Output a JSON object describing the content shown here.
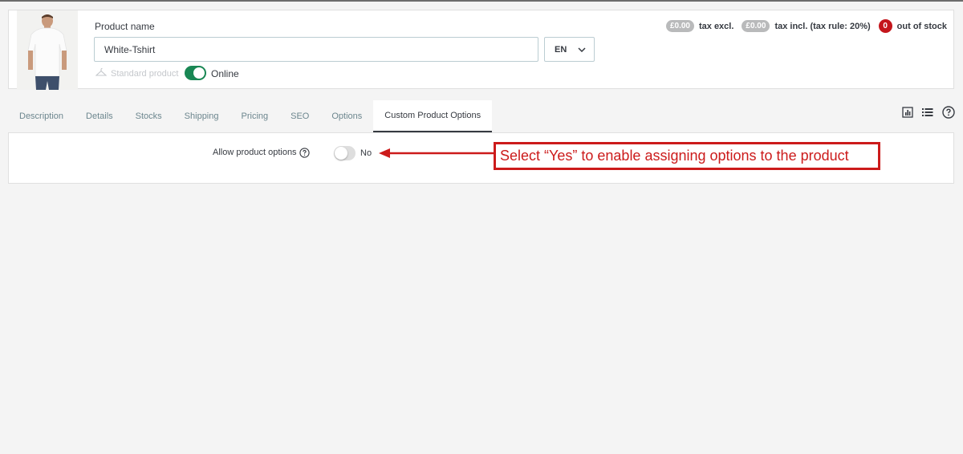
{
  "header": {
    "product_image_alt": "White T-shirt product photo",
    "product_name_label": "Product name",
    "product_name_value": "White-Tshirt",
    "language": "EN",
    "product_type": "Standard product",
    "status_label": "Online",
    "status_online": true
  },
  "price_bar": {
    "price_tax_excl": "£0.00",
    "tax_excl_label": "tax excl.",
    "price_tax_incl": "£0.00",
    "tax_incl_label": "tax incl. (tax rule: 20%)",
    "stock_count": "0",
    "stock_label": "out of stock"
  },
  "tabs": [
    {
      "label": "Description"
    },
    {
      "label": "Details"
    },
    {
      "label": "Stocks"
    },
    {
      "label": "Shipping"
    },
    {
      "label": "Pricing"
    },
    {
      "label": "SEO"
    },
    {
      "label": "Options"
    },
    {
      "label": "Custom Product Options",
      "active": true
    }
  ],
  "tab_icons": [
    "stats-icon",
    "list-icon",
    "help-icon"
  ],
  "custom_options": {
    "allow_label": "Allow product options",
    "allow_value": "No",
    "allow_enabled": false
  },
  "annotation": {
    "text": "Select “Yes” to enable assigning options to the product",
    "color": "#cc1b1b"
  },
  "colors": {
    "online_toggle": "#198754",
    "stock_badge": "#c4161c",
    "price_pill": "#b9babb"
  }
}
